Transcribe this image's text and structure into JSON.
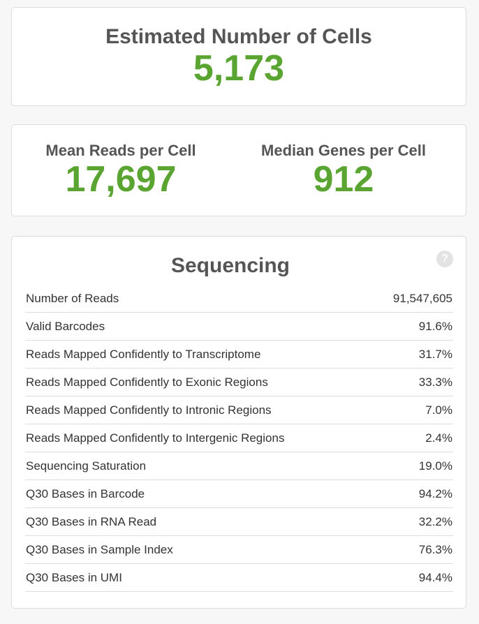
{
  "estimated_cells": {
    "title": "Estimated Number of Cells",
    "value": "5,173"
  },
  "stats": {
    "mean_reads": {
      "title": "Mean Reads per Cell",
      "value": "17,697"
    },
    "median_genes": {
      "title": "Median Genes per Cell",
      "value": "912"
    }
  },
  "sequencing": {
    "title": "Sequencing",
    "help_icon": "?",
    "rows": [
      {
        "label": "Number of Reads",
        "value": "91,547,605"
      },
      {
        "label": "Valid Barcodes",
        "value": "91.6%"
      },
      {
        "label": "Reads Mapped Confidently to Transcriptome",
        "value": "31.7%"
      },
      {
        "label": "Reads Mapped Confidently to Exonic Regions",
        "value": "33.3%"
      },
      {
        "label": "Reads Mapped Confidently to Intronic Regions",
        "value": "7.0%"
      },
      {
        "label": "Reads Mapped Confidently to Intergenic Regions",
        "value": "2.4%"
      },
      {
        "label": "Sequencing Saturation",
        "value": "19.0%"
      },
      {
        "label": "Q30 Bases in Barcode",
        "value": "94.2%"
      },
      {
        "label": "Q30 Bases in RNA Read",
        "value": "32.2%"
      },
      {
        "label": "Q30 Bases in Sample Index",
        "value": "76.3%"
      },
      {
        "label": "Q30 Bases in UMI",
        "value": "94.4%"
      }
    ]
  },
  "colors": {
    "accent_green": "#5aa532",
    "title_gray": "#555555"
  }
}
